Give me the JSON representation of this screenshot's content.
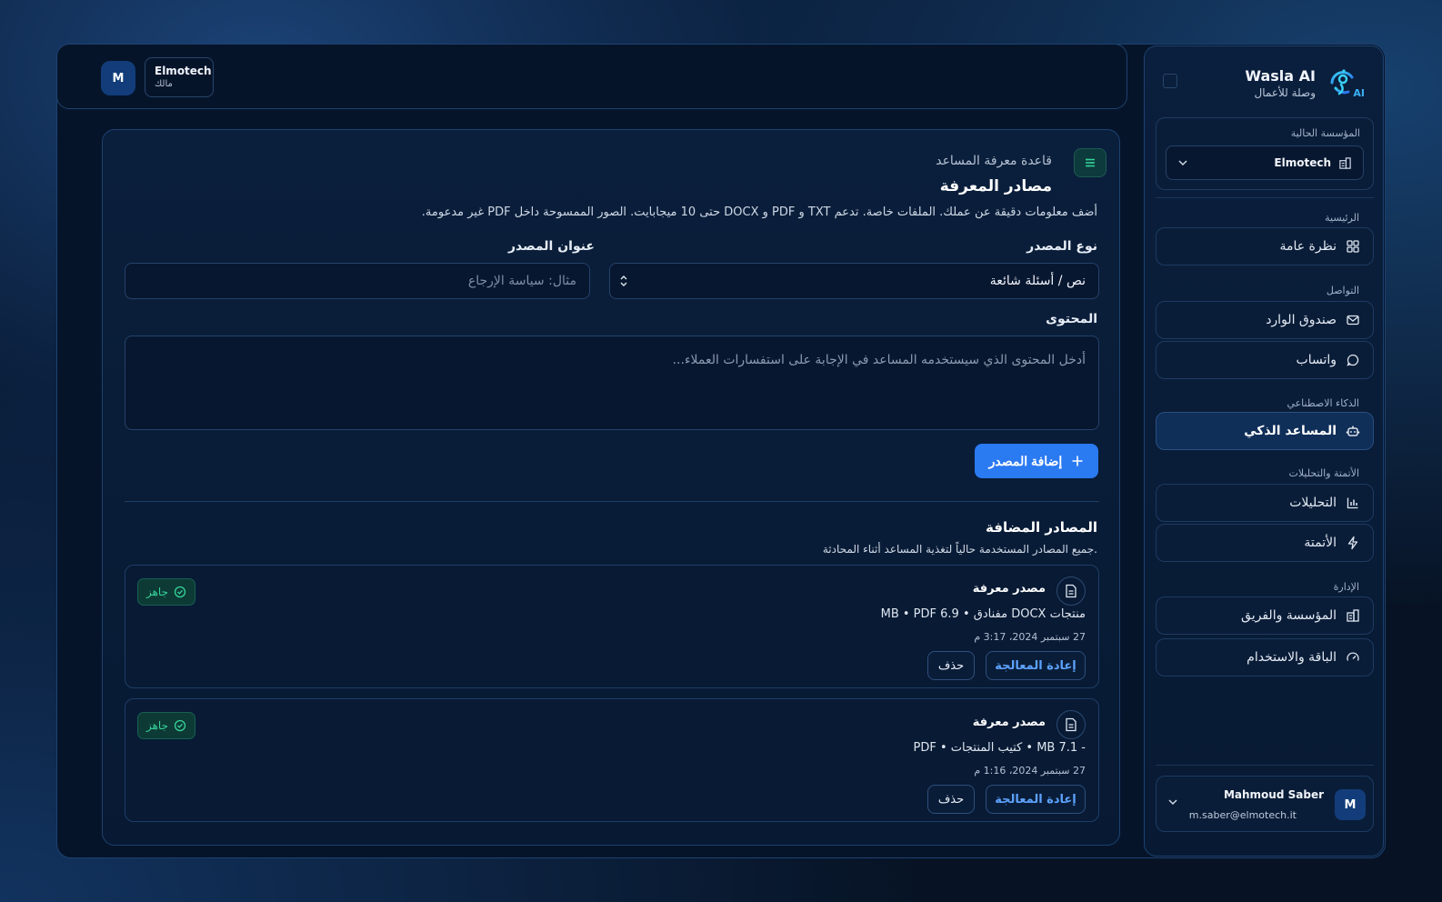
{
  "brand": {
    "name": "Wasla AI",
    "subtitle": "وصلة للأعمال",
    "logo_badge": "AI"
  },
  "sidebar": {
    "org_label": "المؤسسة الحالية",
    "org_value": "Elmotech",
    "sections": {
      "main": "الرئيسية",
      "communication": "التواصل",
      "ai": "الذكاء الاصطناعي",
      "automation": "الأتمتة والتحليلات",
      "admin": "الإدارة"
    },
    "items": {
      "overview": "نظرة عامة",
      "inbox": "صندوق الوارد",
      "whatsapp": "واتساب",
      "assistant": "المساعد الذكي",
      "analytics": "التحليلات",
      "automation": "الأتمتة",
      "org_team": "المؤسسة والفريق",
      "plan_usage": "الباقة والاستخدام"
    },
    "user": {
      "initial": "M",
      "name": "Mahmoud Saber",
      "email": "m.saber@elmotech.it"
    }
  },
  "topbar": {
    "avatar_initial": "M",
    "org_name": "Elmotech",
    "role": "مالك"
  },
  "knowledge": {
    "eyebrow": "قاعدة معرفة المساعد",
    "title": "مصادر المعرفة",
    "description": "أضف معلومات دقيقة عن عملك. الملفات خاصة. تدعم TXT و PDF و DOCX حتى 10 ميجابايت. الصور الممسوحة داخل PDF غير مدعومة.",
    "source_type_label": "نوع المصدر",
    "source_type_value": "نص / أسئلة شائعة",
    "source_title_label": "عنوان المصدر",
    "source_title_placeholder": "مثال: سياسة الإرجاع",
    "content_label": "المحتوى",
    "content_placeholder": "أدخل المحتوى الذي سيستخدمه المساعد في الإجابة على استفسارات العملاء...",
    "add_button": "إضافة المصدر"
  },
  "added_sources": {
    "title": "المصادر المضافة",
    "subtitle": "جميع المصادر المستخدمة حالياً لتغذية المساعد أثناء المحادثة.",
    "items": [
      {
        "name": "مصدر معرفة",
        "meta": "منتجات DOCX مفنادق • 6.9 MB • PDF",
        "date": "27 سبتمبر 2024، 3:17 م",
        "status": "جاهز",
        "reprocess": "إعادة المعالجة",
        "delete": "حذف"
      },
      {
        "name": "مصدر معرفة",
        "meta": "- 7.1 MB • كتيب المنتجات • PDF",
        "date": "27 سبتمبر 2024، 1:16 م",
        "status": "جاهز",
        "reprocess": "إعادة المعالجة",
        "delete": "حذف"
      }
    ]
  },
  "colors": {
    "accent": "#2a7af2",
    "success": "#35d399",
    "background": "#071325"
  }
}
